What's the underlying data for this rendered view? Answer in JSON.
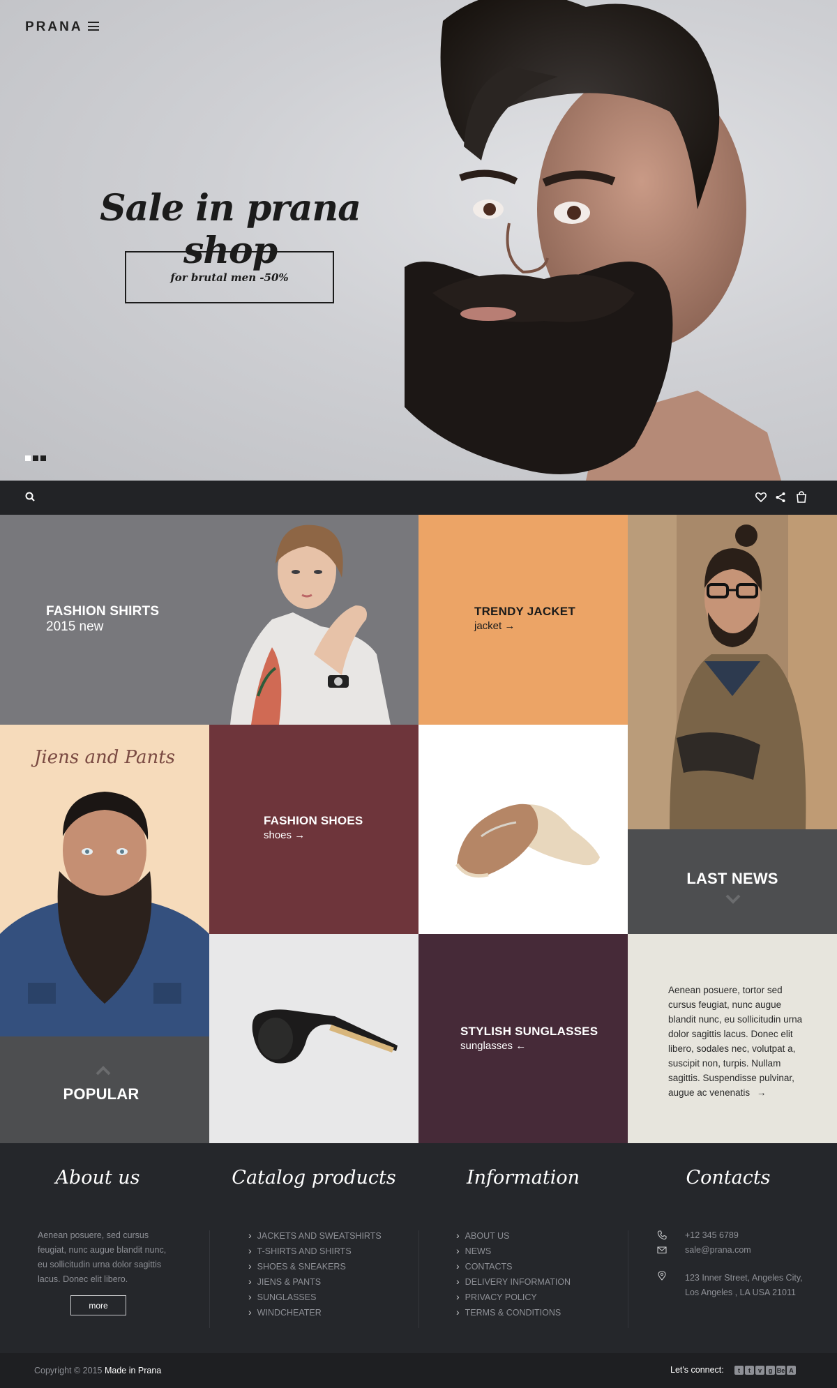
{
  "header": {
    "logo": "PRANA",
    "menu_icon": "hamburger-icon"
  },
  "hero": {
    "title": "Sale in prana shop",
    "button_label": "for brutal men -50%",
    "slides": 3,
    "active_slide": 1
  },
  "toolbar": {
    "left_icon": "search-icon",
    "right_icons": [
      "heart-icon",
      "share-icon",
      "bag-icon"
    ]
  },
  "tiles": {
    "fashion_shirts": {
      "title": "FASHION SHIRTS",
      "subtitle": "2015 new",
      "color": "#78787c"
    },
    "trendy_jacket": {
      "title": "TRENDY JACKET",
      "subtitle": "jacket →",
      "color": "#eca466"
    },
    "jiens_pants": {
      "script": "Jiens and Pants",
      "color": "#f6dbbb"
    },
    "fashion_shoes": {
      "title": "FASHION SHOES",
      "subtitle": "shoes →",
      "color": "#6e353b"
    },
    "last_news": {
      "title": "LAST NEWS",
      "color": "#4d4e50"
    },
    "popular": {
      "title": "POPULAR",
      "color": "#4d4e50"
    },
    "stylish_sunglasses": {
      "title": "STYLISH SUNGLASSES",
      "subtitle": "sunglasses ←",
      "color": "#462a38"
    },
    "news_text": {
      "body": "Aenean posuere, tortor sed cursus feugiat, nunc augue blandit nunc, eu sollicitudin urna dolor sagittis lacus. Donec elit libero, sodales nec, volutpat a, suscipit non, turpis. Nullam sagittis. Suspendisse pulvinar, augue ac venenatis",
      "arrow": "→",
      "color": "#e7e5dd"
    }
  },
  "footer": {
    "about": {
      "heading": "About us",
      "text": "Aenean posuere, sed cursus feugiat, nunc augue blandit nunc, eu sollicitudin urna dolor sagittis lacus. Donec elit libero.",
      "more": "more"
    },
    "catalog": {
      "heading": "Catalog products",
      "items": [
        "JACKETS AND SWEATSHIRTS",
        "T-SHIRTS AND SHIRTS",
        "SHOES & SNEAKERS",
        "JIENS & PANTS",
        "SUNGLASSES",
        "WINDCHEATER"
      ]
    },
    "information": {
      "heading": "Information",
      "items": [
        "ABOUT US",
        "NEWS",
        "CONTACTS",
        "DELIVERY INFORMATION",
        "PRIVACY POLICY",
        "TERMS & CONDITIONS"
      ]
    },
    "contacts": {
      "heading": "Contacts",
      "phone": "+12 345 6789",
      "email": "sale@prana.com",
      "address_line1": "123 Inner Street, Angeles City,",
      "address_line2": "Los Angeles , LA USA 21011"
    }
  },
  "bottombar": {
    "copyright": "Copyright © 2015",
    "made_in": "Made in Prana",
    "connect_label": "Let's connect:",
    "social": [
      "t",
      "t",
      "v",
      "g",
      "Be",
      "A"
    ]
  }
}
